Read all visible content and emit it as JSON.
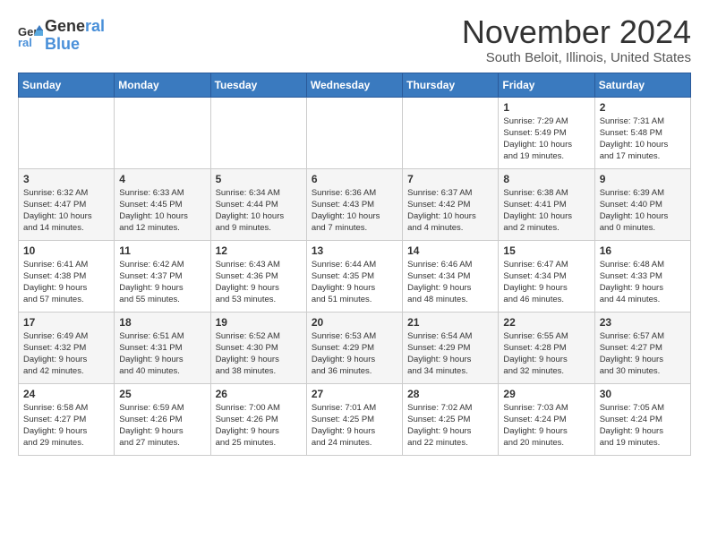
{
  "logo": {
    "line1": "General",
    "line2": "Blue"
  },
  "title": "November 2024",
  "location": "South Beloit, Illinois, United States",
  "days_of_week": [
    "Sunday",
    "Monday",
    "Tuesday",
    "Wednesday",
    "Thursday",
    "Friday",
    "Saturday"
  ],
  "weeks": [
    [
      {
        "day": "",
        "info": ""
      },
      {
        "day": "",
        "info": ""
      },
      {
        "day": "",
        "info": ""
      },
      {
        "day": "",
        "info": ""
      },
      {
        "day": "",
        "info": ""
      },
      {
        "day": "1",
        "info": "Sunrise: 7:29 AM\nSunset: 5:49 PM\nDaylight: 10 hours\nand 19 minutes."
      },
      {
        "day": "2",
        "info": "Sunrise: 7:31 AM\nSunset: 5:48 PM\nDaylight: 10 hours\nand 17 minutes."
      }
    ],
    [
      {
        "day": "3",
        "info": "Sunrise: 6:32 AM\nSunset: 4:47 PM\nDaylight: 10 hours\nand 14 minutes."
      },
      {
        "day": "4",
        "info": "Sunrise: 6:33 AM\nSunset: 4:45 PM\nDaylight: 10 hours\nand 12 minutes."
      },
      {
        "day": "5",
        "info": "Sunrise: 6:34 AM\nSunset: 4:44 PM\nDaylight: 10 hours\nand 9 minutes."
      },
      {
        "day": "6",
        "info": "Sunrise: 6:36 AM\nSunset: 4:43 PM\nDaylight: 10 hours\nand 7 minutes."
      },
      {
        "day": "7",
        "info": "Sunrise: 6:37 AM\nSunset: 4:42 PM\nDaylight: 10 hours\nand 4 minutes."
      },
      {
        "day": "8",
        "info": "Sunrise: 6:38 AM\nSunset: 4:41 PM\nDaylight: 10 hours\nand 2 minutes."
      },
      {
        "day": "9",
        "info": "Sunrise: 6:39 AM\nSunset: 4:40 PM\nDaylight: 10 hours\nand 0 minutes."
      }
    ],
    [
      {
        "day": "10",
        "info": "Sunrise: 6:41 AM\nSunset: 4:38 PM\nDaylight: 9 hours\nand 57 minutes."
      },
      {
        "day": "11",
        "info": "Sunrise: 6:42 AM\nSunset: 4:37 PM\nDaylight: 9 hours\nand 55 minutes."
      },
      {
        "day": "12",
        "info": "Sunrise: 6:43 AM\nSunset: 4:36 PM\nDaylight: 9 hours\nand 53 minutes."
      },
      {
        "day": "13",
        "info": "Sunrise: 6:44 AM\nSunset: 4:35 PM\nDaylight: 9 hours\nand 51 minutes."
      },
      {
        "day": "14",
        "info": "Sunrise: 6:46 AM\nSunset: 4:34 PM\nDaylight: 9 hours\nand 48 minutes."
      },
      {
        "day": "15",
        "info": "Sunrise: 6:47 AM\nSunset: 4:34 PM\nDaylight: 9 hours\nand 46 minutes."
      },
      {
        "day": "16",
        "info": "Sunrise: 6:48 AM\nSunset: 4:33 PM\nDaylight: 9 hours\nand 44 minutes."
      }
    ],
    [
      {
        "day": "17",
        "info": "Sunrise: 6:49 AM\nSunset: 4:32 PM\nDaylight: 9 hours\nand 42 minutes."
      },
      {
        "day": "18",
        "info": "Sunrise: 6:51 AM\nSunset: 4:31 PM\nDaylight: 9 hours\nand 40 minutes."
      },
      {
        "day": "19",
        "info": "Sunrise: 6:52 AM\nSunset: 4:30 PM\nDaylight: 9 hours\nand 38 minutes."
      },
      {
        "day": "20",
        "info": "Sunrise: 6:53 AM\nSunset: 4:29 PM\nDaylight: 9 hours\nand 36 minutes."
      },
      {
        "day": "21",
        "info": "Sunrise: 6:54 AM\nSunset: 4:29 PM\nDaylight: 9 hours\nand 34 minutes."
      },
      {
        "day": "22",
        "info": "Sunrise: 6:55 AM\nSunset: 4:28 PM\nDaylight: 9 hours\nand 32 minutes."
      },
      {
        "day": "23",
        "info": "Sunrise: 6:57 AM\nSunset: 4:27 PM\nDaylight: 9 hours\nand 30 minutes."
      }
    ],
    [
      {
        "day": "24",
        "info": "Sunrise: 6:58 AM\nSunset: 4:27 PM\nDaylight: 9 hours\nand 29 minutes."
      },
      {
        "day": "25",
        "info": "Sunrise: 6:59 AM\nSunset: 4:26 PM\nDaylight: 9 hours\nand 27 minutes."
      },
      {
        "day": "26",
        "info": "Sunrise: 7:00 AM\nSunset: 4:26 PM\nDaylight: 9 hours\nand 25 minutes."
      },
      {
        "day": "27",
        "info": "Sunrise: 7:01 AM\nSunset: 4:25 PM\nDaylight: 9 hours\nand 24 minutes."
      },
      {
        "day": "28",
        "info": "Sunrise: 7:02 AM\nSunset: 4:25 PM\nDaylight: 9 hours\nand 22 minutes."
      },
      {
        "day": "29",
        "info": "Sunrise: 7:03 AM\nSunset: 4:24 PM\nDaylight: 9 hours\nand 20 minutes."
      },
      {
        "day": "30",
        "info": "Sunrise: 7:05 AM\nSunset: 4:24 PM\nDaylight: 9 hours\nand 19 minutes."
      }
    ]
  ]
}
